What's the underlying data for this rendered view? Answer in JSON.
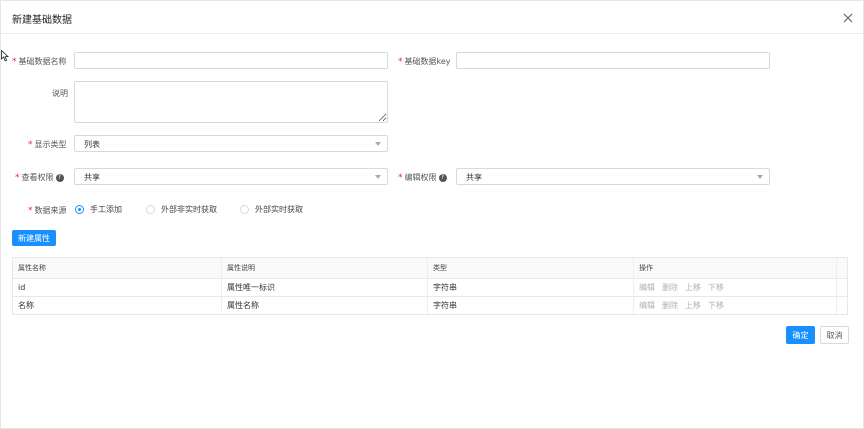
{
  "dialog": {
    "title": "新建基础数据"
  },
  "form": {
    "name_label": "基础数据名称",
    "key_label": "基础数据key",
    "desc_label": "说明",
    "display_type_label": "显示类型",
    "display_type_value": "列表",
    "view_perm_label": "查看权限",
    "view_perm_value": "共享",
    "edit_perm_label": "编辑权限",
    "edit_perm_value": "共享",
    "source_label": "数据来源",
    "source_options": [
      {
        "label": "手工添加",
        "checked": true
      },
      {
        "label": "外部非实时获取",
        "checked": false
      },
      {
        "label": "外部实时获取",
        "checked": false
      }
    ],
    "new_attr_button": "新建属性",
    "required_mark": "*",
    "help_mark": "?"
  },
  "table": {
    "columns": [
      "属性名称",
      "属性说明",
      "类型",
      "操作"
    ],
    "rows": [
      {
        "name": "id",
        "desc": "属性唯一标识",
        "type": "字符串"
      },
      {
        "name": "名称",
        "desc": "属性名称",
        "type": "字符串"
      }
    ],
    "actions": [
      "编辑",
      "删除",
      "上移",
      "下移"
    ]
  },
  "footer": {
    "ok_button": "确定",
    "cancel_button": "取消"
  },
  "colors": {
    "primary": "#1890ff",
    "required": "#f5222d",
    "border": "#d9d9d9"
  },
  "icons": {
    "close": "close-icon",
    "dropdown": "chevron-down-icon",
    "help": "question-circle-icon",
    "cursor": "mouse-cursor-icon"
  }
}
